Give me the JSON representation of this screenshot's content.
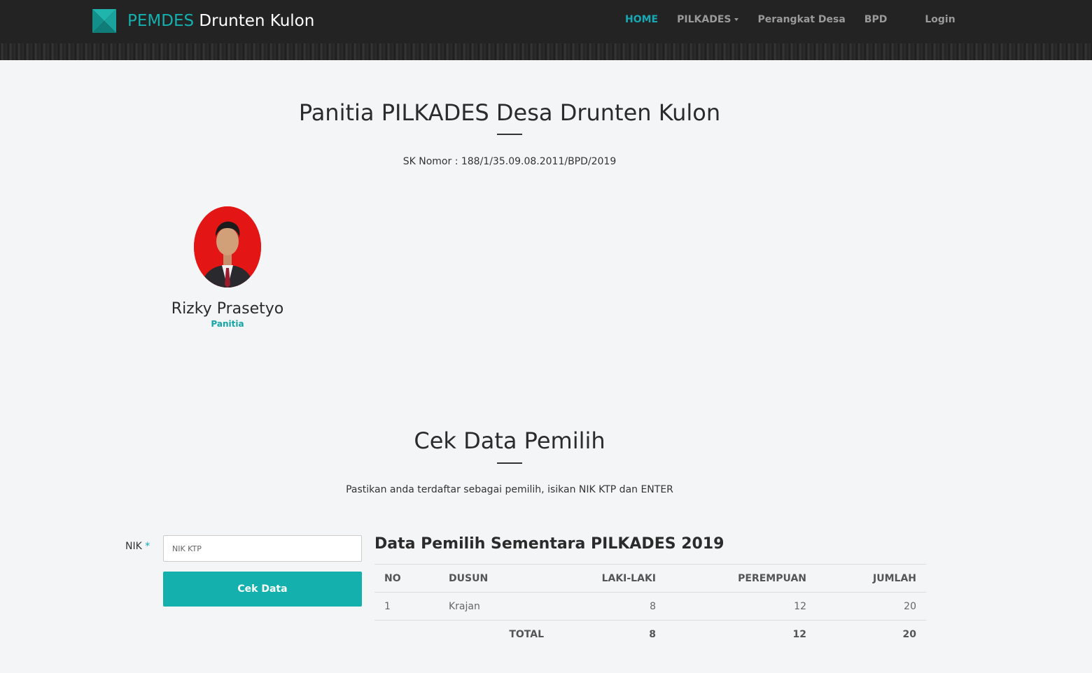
{
  "navbar": {
    "brand_accent": "PEMDES",
    "brand_rest": " Drunten Kulon",
    "items": [
      {
        "label": "HOME"
      },
      {
        "label": "PILKADES"
      },
      {
        "label": "Perangkat Desa"
      },
      {
        "label": "BPD"
      },
      {
        "label": "Login"
      }
    ]
  },
  "panitia": {
    "title": "Panitia PILKADES Desa Drunten Kulon",
    "sk": "SK Nomor : 188/1/35.09.08.2011/BPD/2019",
    "member": {
      "name": "Rizky Prasetyo",
      "role": "Panitia"
    }
  },
  "cek": {
    "title": "Cek Data Pemilih",
    "subtitle": "Pastikan anda terdaftar sebagai pemilih, isikan NIK KTP dan ENTER",
    "nik_label": "NIK",
    "required_mark": "*",
    "nik_placeholder": "NIK KTP",
    "button_label": "Cek Data"
  },
  "table": {
    "title": "Data Pemilih Sementara PILKADES 2019",
    "headers": [
      "NO",
      "DUSUN",
      "LAKI-LAKI",
      "PEREMPUAN",
      "JUMLAH"
    ],
    "rows": [
      [
        "1",
        "Krajan",
        "8",
        "12",
        "20"
      ]
    ],
    "total": {
      "label": "TOTAL",
      "laki": "8",
      "perempuan": "12",
      "jumlah": "20"
    }
  },
  "colors": {
    "accent": "#14b0ad",
    "nav_bg": "#232323",
    "avatar_bg": "#e41515"
  }
}
